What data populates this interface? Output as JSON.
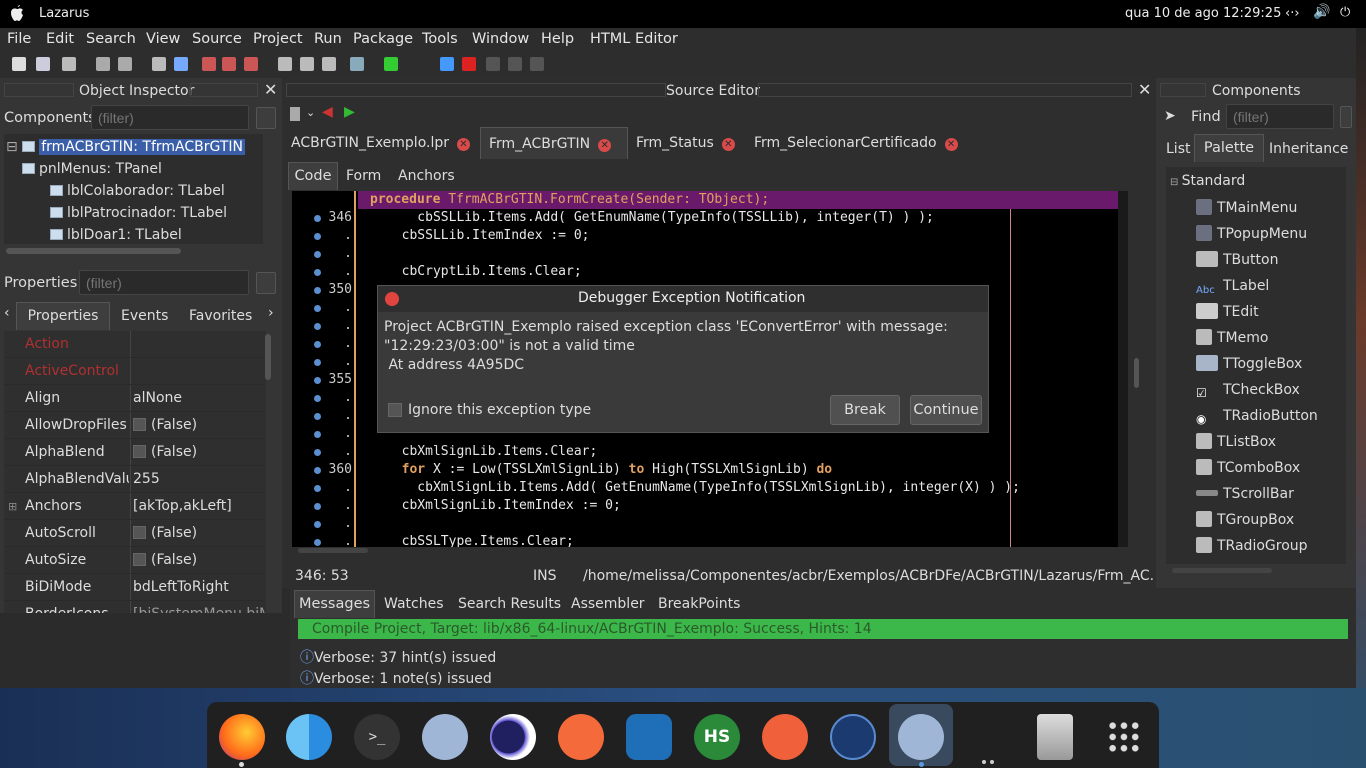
{
  "topbar": {
    "app": "Lazarus",
    "clock": "qua 10 de ago  12:29:25"
  },
  "menu": [
    "File",
    "Edit",
    "Search",
    "View",
    "Source",
    "Project",
    "Run",
    "Package",
    "Tools",
    "Window",
    "Help",
    "HTML Editor"
  ],
  "oi": {
    "title": "Object Inspector",
    "components_label": "Components",
    "filter_placeholder": "(filter)",
    "tree": [
      "frmACBrGTIN: TfrmACBrGTIN",
      "pnlMenus: TPanel",
      "lblColaborador: TLabel",
      "lblPatrocinador: TLabel",
      "lblDoar1: TLabel"
    ],
    "properties_label": "Properties",
    "tabs": [
      "Properties",
      "Events",
      "Favorites"
    ],
    "props": [
      {
        "n": "Action",
        "v": ""
      },
      {
        "n": "ActiveControl",
        "v": ""
      },
      {
        "n": "Align",
        "v": "alNone"
      },
      {
        "n": "AllowDropFiles",
        "v": "(False)"
      },
      {
        "n": "AlphaBlend",
        "v": "(False)"
      },
      {
        "n": "AlphaBlendValu",
        "v": "255"
      },
      {
        "n": "Anchors",
        "v": "[akTop,akLeft]"
      },
      {
        "n": "AutoScroll",
        "v": "(False)"
      },
      {
        "n": "AutoSize",
        "v": "(False)"
      },
      {
        "n": "BiDiMode",
        "v": "bdLeftToRight"
      },
      {
        "n": "BorderIcons",
        "v": "[biSystemMenu,biM"
      }
    ]
  },
  "editor": {
    "title": "Source Editor",
    "tabs": [
      "ACBrGTIN_Exemplo.lpr",
      "Frm_ACBrGTIN",
      "Frm_Status",
      "Frm_SelecionarCertificado"
    ],
    "subtabs": [
      "Code",
      "Form",
      "Anchors"
    ],
    "header_line": "procedure TfrmACBrGTIN.FormCreate(Sender: TObject);",
    "lines": [
      {
        "n": "346",
        "t": "    cbSSLLib.Items.Add( GetEnumName(TypeInfo(TSSLLib), integer(T) ) );"
      },
      {
        "n": ".",
        "t": "  cbSSLLib.ItemIndex := 0;"
      },
      {
        "n": ".",
        "t": ""
      },
      {
        "n": ".",
        "t": "  cbCryptLib.Items.Clear;"
      },
      {
        "n": "350",
        "t": ""
      },
      {
        "n": ".",
        "t": ""
      },
      {
        "n": ".",
        "t": ""
      },
      {
        "n": ".",
        "t": ""
      },
      {
        "n": ".",
        "t": ""
      },
      {
        "n": "355",
        "t": ""
      },
      {
        "n": ".",
        "t": ""
      },
      {
        "n": ".",
        "t": ""
      },
      {
        "n": ".",
        "t": ""
      },
      {
        "n": ".",
        "t": "  cbXmlSignLib.Items.Clear;"
      },
      {
        "n": "360",
        "t": "  for X := Low(TSSLXmlSignLib) to High(TSSLXmlSignLib) do"
      },
      {
        "n": ".",
        "t": "    cbXmlSignLib.Items.Add( GetEnumName(TypeInfo(TSSLXmlSignLib), integer(X) ) );"
      },
      {
        "n": ".",
        "t": "  cbXmlSignLib.ItemIndex := 0;"
      },
      {
        "n": ".",
        "t": ""
      },
      {
        "n": ".",
        "t": "  cbSSLType.Items.Clear;"
      }
    ],
    "status": {
      "pos": "346: 53",
      "mode": "INS",
      "path": "/home/melissa/Componentes/acbr/Exemplos/ACBrDFe/ACBrGTIN/Lazarus/Frm_AC..."
    }
  },
  "dialog": {
    "title": "Debugger Exception Notification",
    "msg1": "Project ACBrGTIN_Exemplo raised exception class 'EConvertError' with message:",
    "msg2": "\"12:29:23/03:00\" is not a valid time",
    "msg3": " At address 4A95DC",
    "ignore": "Ignore this exception type",
    "break": "Break",
    "continue": "Continue"
  },
  "messages": {
    "tabs": [
      "Messages",
      "Watches",
      "Search Results",
      "Assembler",
      "BreakPoints"
    ],
    "compile": "Compile Project, Target: lib/x86_64-linux/ACBrGTIN_Exemplo: Success, Hints: 14",
    "items": [
      "Verbose: 37 hint(s) issued",
      "Verbose: 1 note(s) issued"
    ]
  },
  "palette": {
    "title": "Components",
    "find": "Find",
    "filter_placeholder": "(filter)",
    "tabs": [
      "List",
      "Palette",
      "Inheritance"
    ],
    "group": "Standard",
    "items": [
      "TMainMenu",
      "TPopupMenu",
      "TButton",
      "TLabel",
      "TEdit",
      "TMemo",
      "TToggleBox",
      "TCheckBox",
      "TRadioButton",
      "TListBox",
      "TComboBox",
      "TScrollBar",
      "TGroupBox",
      "TRadioGroup"
    ]
  },
  "dock": {
    "hs_label": "HS"
  }
}
